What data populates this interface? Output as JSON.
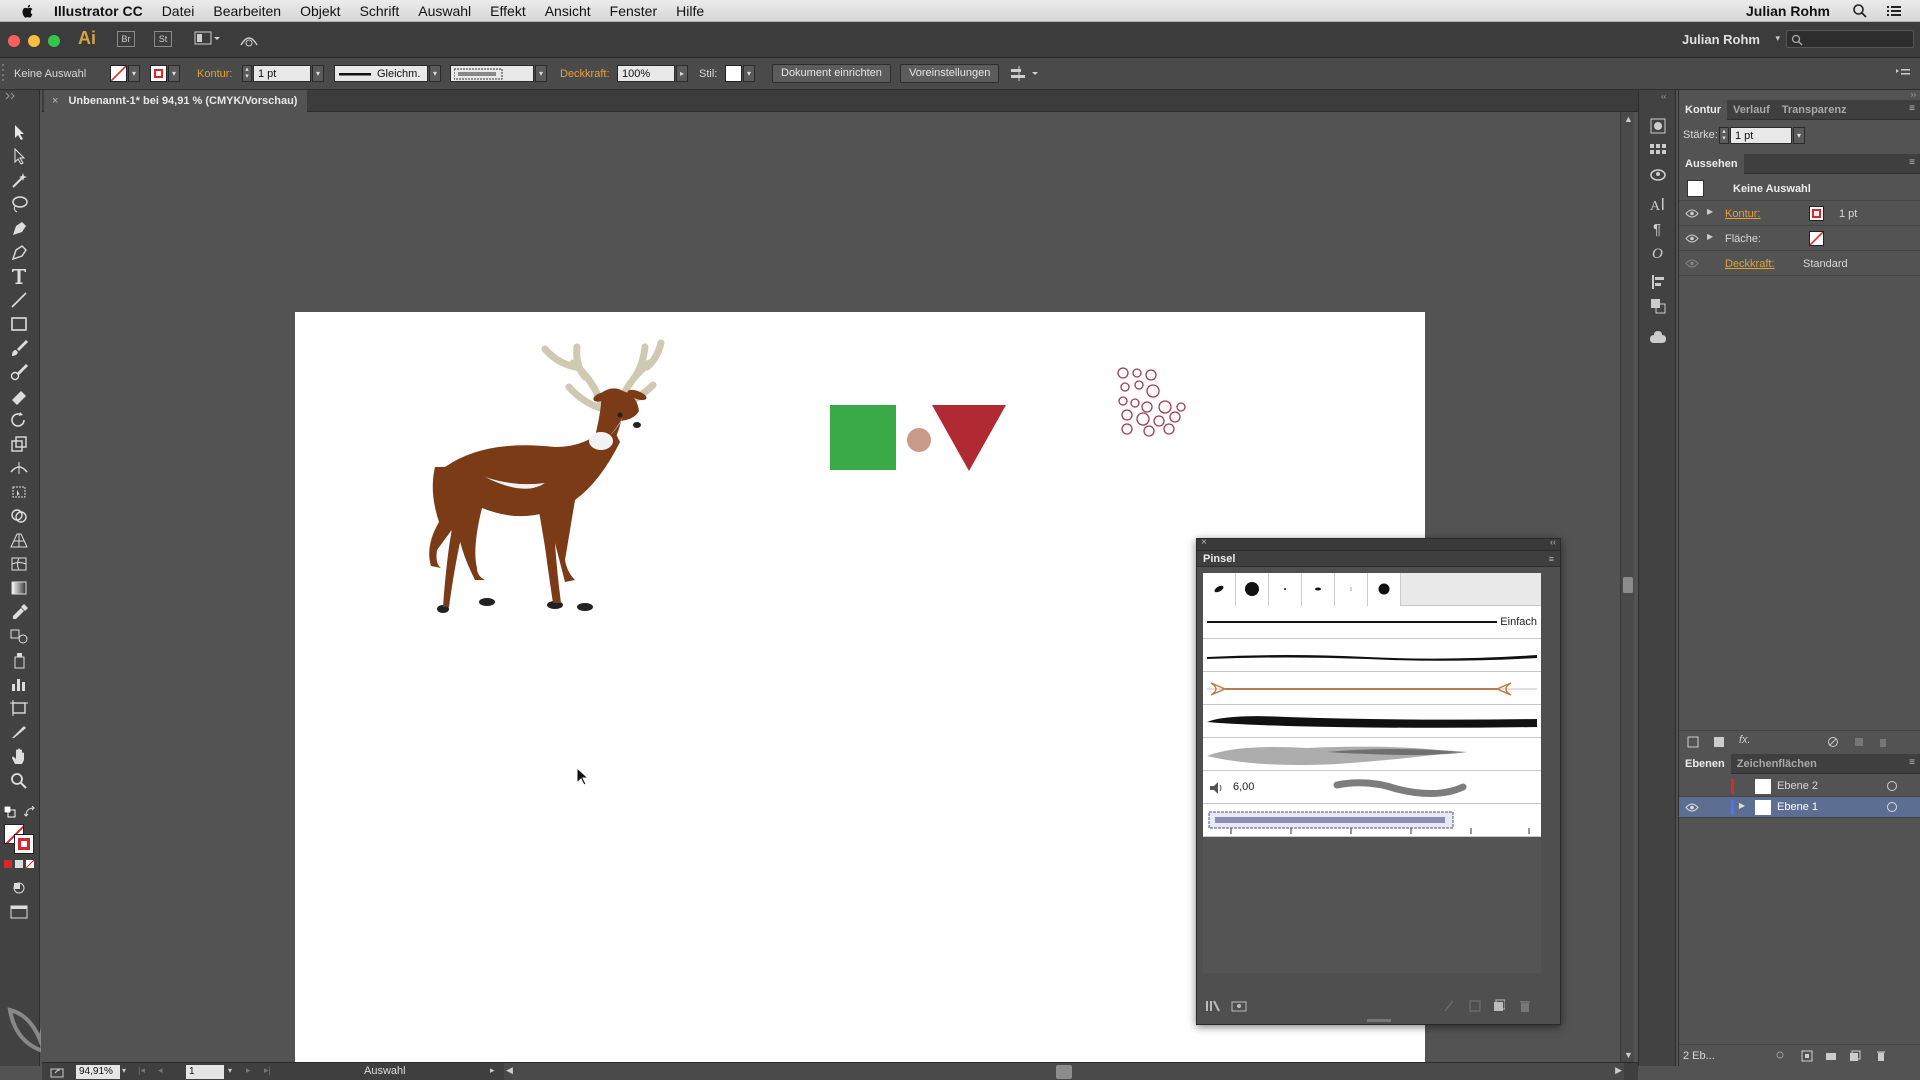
{
  "menubar": {
    "app": "Illustrator CC",
    "items": [
      "Datei",
      "Bearbeiten",
      "Objekt",
      "Schrift",
      "Auswahl",
      "Effekt",
      "Ansicht",
      "Fenster",
      "Hilfe"
    ],
    "user": "Julian Rohm"
  },
  "appbar": {
    "logo": "Ai",
    "bridge": "Br",
    "stock": "St",
    "workspace": "Julian Rohm"
  },
  "control": {
    "selection": "Keine Auswahl",
    "stroke_label": "Kontur:",
    "stroke_value": "1 pt",
    "profile": "Gleichm.",
    "opacity_label": "Deckkraft:",
    "opacity_value": "100%",
    "style_label": "Stil:",
    "doc_setup": "Dokument einrichten",
    "preferences": "Voreinstellungen"
  },
  "document": {
    "tab": "Unbenannt-1* bei 94,91 % (CMYK/Vorschau)"
  },
  "panels": {
    "stroke_tabs": [
      "Kontur",
      "Verlauf",
      "Transparenz"
    ],
    "weight_label": "Stärke:",
    "weight_value": "1 pt",
    "appearance_title": "Aussehen",
    "appearance_selection": "Keine Auswahl",
    "appearance_rows": [
      {
        "label": "Kontur:",
        "value": "1 pt"
      },
      {
        "label": "Fläche:",
        "value": ""
      },
      {
        "label": "Deckkraft:",
        "value": "Standard"
      }
    ],
    "layers_tabs": [
      "Ebenen",
      "Zeichenflächen"
    ],
    "layers": [
      "Ebene 2",
      "Ebene 1"
    ],
    "layers_count": "2 Eb..."
  },
  "brush_panel": {
    "title": "Pinsel",
    "basic_label": "Einfach",
    "bristle_value": "6,00"
  },
  "status": {
    "zoom": "94,91%",
    "page": "1",
    "mode": "Auswahl"
  },
  "colors": {
    "green": "#3aaa49",
    "red": "#b12a33",
    "dot": "#c79a8a",
    "deer": "#7a3b16",
    "antler": "#cfc8b2",
    "accent_orange": "#e3a23b"
  }
}
